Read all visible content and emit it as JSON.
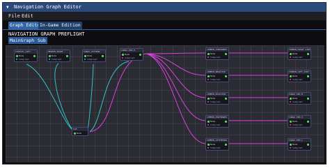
{
  "window": {
    "title": "Navigation Graph Editor",
    "collapse_glyph": "▼"
  },
  "menu": [
    "File",
    "Edit"
  ],
  "tabs": [
    {
      "label": "Graph Editor",
      "active": true
    },
    {
      "label": "In-Game Edition",
      "active": false
    }
  ],
  "page_title": "NAVIGATION GRAPH PREFLIGHT",
  "buttons": {
    "maingraph": "MainGraph 3",
    "sub": "Sub"
  },
  "colors": {
    "titlebar": "#294a7a",
    "tab_active": "#3166a8",
    "canvas": "#2b2b33",
    "wire_cyan": "#2ec5c5",
    "wire_magenta": "#e040e0",
    "pin": "#4cd964"
  },
  "nodes": [
    {
      "id": "n1",
      "title": "COCKLEL_LOFT"
    },
    {
      "id": "n2",
      "title": "HEADER_RIGHT"
    },
    {
      "id": "n3",
      "title": "CARGO_LETTERS"
    },
    {
      "id": "n4",
      "title": "CARGO_PIN_H"
    },
    {
      "id": "n5",
      "title": "Sub"
    },
    {
      "id": "m1",
      "title": "COMMON_COMPOUNDS"
    },
    {
      "id": "m2",
      "title": "COMMON_NEGATIVE"
    },
    {
      "id": "m3",
      "title": "COMMON_POSITION"
    },
    {
      "id": "m4",
      "title": "COMMON_PORTBANKS"
    },
    {
      "id": "m5",
      "title": "COMMON_LETTERING"
    },
    {
      "id": "r1",
      "title": "COMMON_RIGHT_STRT"
    },
    {
      "id": "r2",
      "title": "COMMON_LEFT_STRT"
    },
    {
      "id": "r3",
      "title": "CARGO_PIN_M"
    },
    {
      "id": "r4",
      "title": "CARGO_PIN_X"
    },
    {
      "id": "r5",
      "title": "CARGO_PIN_L"
    }
  ],
  "node_labels": {
    "pin": "Node",
    "sub": "Subgraph"
  }
}
